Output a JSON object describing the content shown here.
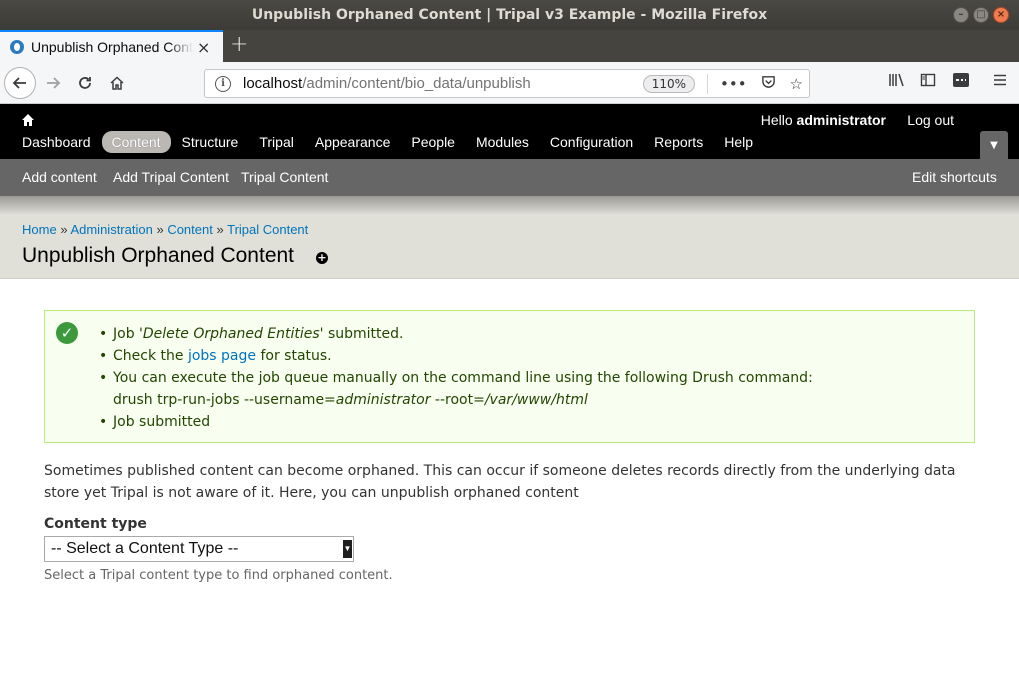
{
  "window": {
    "title": "Unpublish Orphaned Content | Tripal v3 Example - Mozilla Firefox"
  },
  "browser": {
    "tab_title": "Unpublish Orphaned Content",
    "new_tab": "+",
    "url_host": "localhost",
    "url_path": "/admin/content/bio_data/unpublish",
    "zoom": "110%"
  },
  "toolbar": {
    "menu": [
      "Dashboard",
      "Content",
      "Structure",
      "Tripal",
      "Appearance",
      "People",
      "Modules",
      "Configuration",
      "Reports",
      "Help"
    ],
    "active_item": "Content",
    "greeting": "Hello",
    "username": "administrator",
    "logout": "Log out"
  },
  "shortcuts": {
    "items": [
      "Add content",
      "Add Tripal Content",
      "Tripal Content"
    ],
    "edit": "Edit shortcuts"
  },
  "breadcrumb": {
    "items": [
      "Home",
      "Administration",
      "Content",
      "Tripal Content"
    ],
    "separator": "»"
  },
  "page": {
    "title": "Unpublish Orphaned Content"
  },
  "messages": {
    "m1_pre": "Job '",
    "m1_em": "Delete Orphaned Entities",
    "m1_post": "' submitted.",
    "m2_pre": "Check the ",
    "m2_link": "jobs page",
    "m2_post": " for status.",
    "m3_line1": "You can execute the job queue manually on the command line using the following Drush command:",
    "m3_cmd": "drush trp-run-jobs --username=",
    "m3_user": "administrator",
    "m3_root": " --root=",
    "m3_path": "/var/www/html",
    "m4": "Job submitted"
  },
  "content": {
    "intro": "Sometimes published content can become orphaned. This can occur if someone deletes records directly from the underlying data store yet Tripal is not aware of it. Here, you can unpublish orphaned content",
    "field_label": "Content type",
    "select_value": "-- Select a Content Type --",
    "help_text": "Select a Tripal content type to find orphaned content."
  },
  "colors": {
    "link": "#0074bd",
    "toolbar_bg": "#000000",
    "shortcut_bg": "#666666",
    "message_bg": "#f8fff0",
    "message_border": "#bbee77"
  }
}
